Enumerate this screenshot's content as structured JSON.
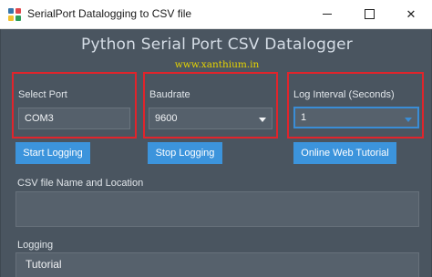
{
  "window": {
    "title": "SerialPort Datalogging to CSV file",
    "minimize_glyph": "",
    "maximize_glyph": "",
    "close_glyph": "✕"
  },
  "header": {
    "title": "Python Serial Port CSV Datalogger",
    "website": "www.xanthium.in"
  },
  "port": {
    "label": "Select Port",
    "value": "COM3"
  },
  "baud": {
    "label": "Baudrate",
    "value": "9600"
  },
  "interval": {
    "label": "Log Interval (Seconds)",
    "value": "1"
  },
  "buttons": {
    "start": "Start Logging",
    "stop": "Stop Logging",
    "tutorial": "Online Web Tutorial"
  },
  "csv": {
    "label": "CSV file Name and Location",
    "value": ""
  },
  "logging": {
    "label": "Logging",
    "text": "Tutorial"
  },
  "colors": {
    "background": "#4a5560",
    "accent": "#3c94dc",
    "highlight_border": "#e1242b",
    "website_text": "#e6d400"
  }
}
